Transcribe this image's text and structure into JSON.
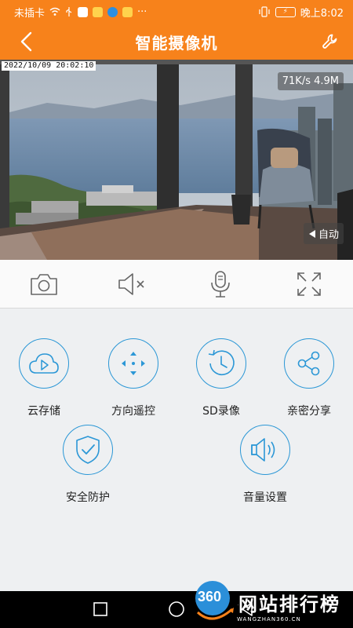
{
  "status_bar": {
    "carrier": "未插卡",
    "time": "晚上8:02",
    "more": "···",
    "battery": "⚡"
  },
  "header": {
    "title": "智能摄像机"
  },
  "video": {
    "timestamp": "2022/10/09 20:02:10",
    "rate": "71K/s 4.9M",
    "auto_label": "自动"
  },
  "controls": [
    {
      "name": "snapshot",
      "icon": "camera-icon"
    },
    {
      "name": "mute",
      "icon": "speaker-mute-icon"
    },
    {
      "name": "talk",
      "icon": "microphone-icon"
    },
    {
      "name": "fullscreen",
      "icon": "fullscreen-icon"
    }
  ],
  "features": [
    {
      "label": "云存储",
      "icon": "cloud-play-icon"
    },
    {
      "label": "方向遥控",
      "icon": "direction-pad-icon"
    },
    {
      "label": "SD录像",
      "icon": "clock-rewind-icon"
    },
    {
      "label": "亲密分享",
      "icon": "share-icon"
    },
    {
      "label": "安全防护",
      "icon": "shield-check-icon"
    },
    {
      "label": "音量设置",
      "icon": "volume-icon"
    }
  ],
  "watermark": {
    "badge": "360",
    "name": "网站排行榜",
    "url": "WANGZHAN360.CN"
  },
  "colors": {
    "accent": "#f7821b",
    "icon_blue": "#2b97d6"
  }
}
